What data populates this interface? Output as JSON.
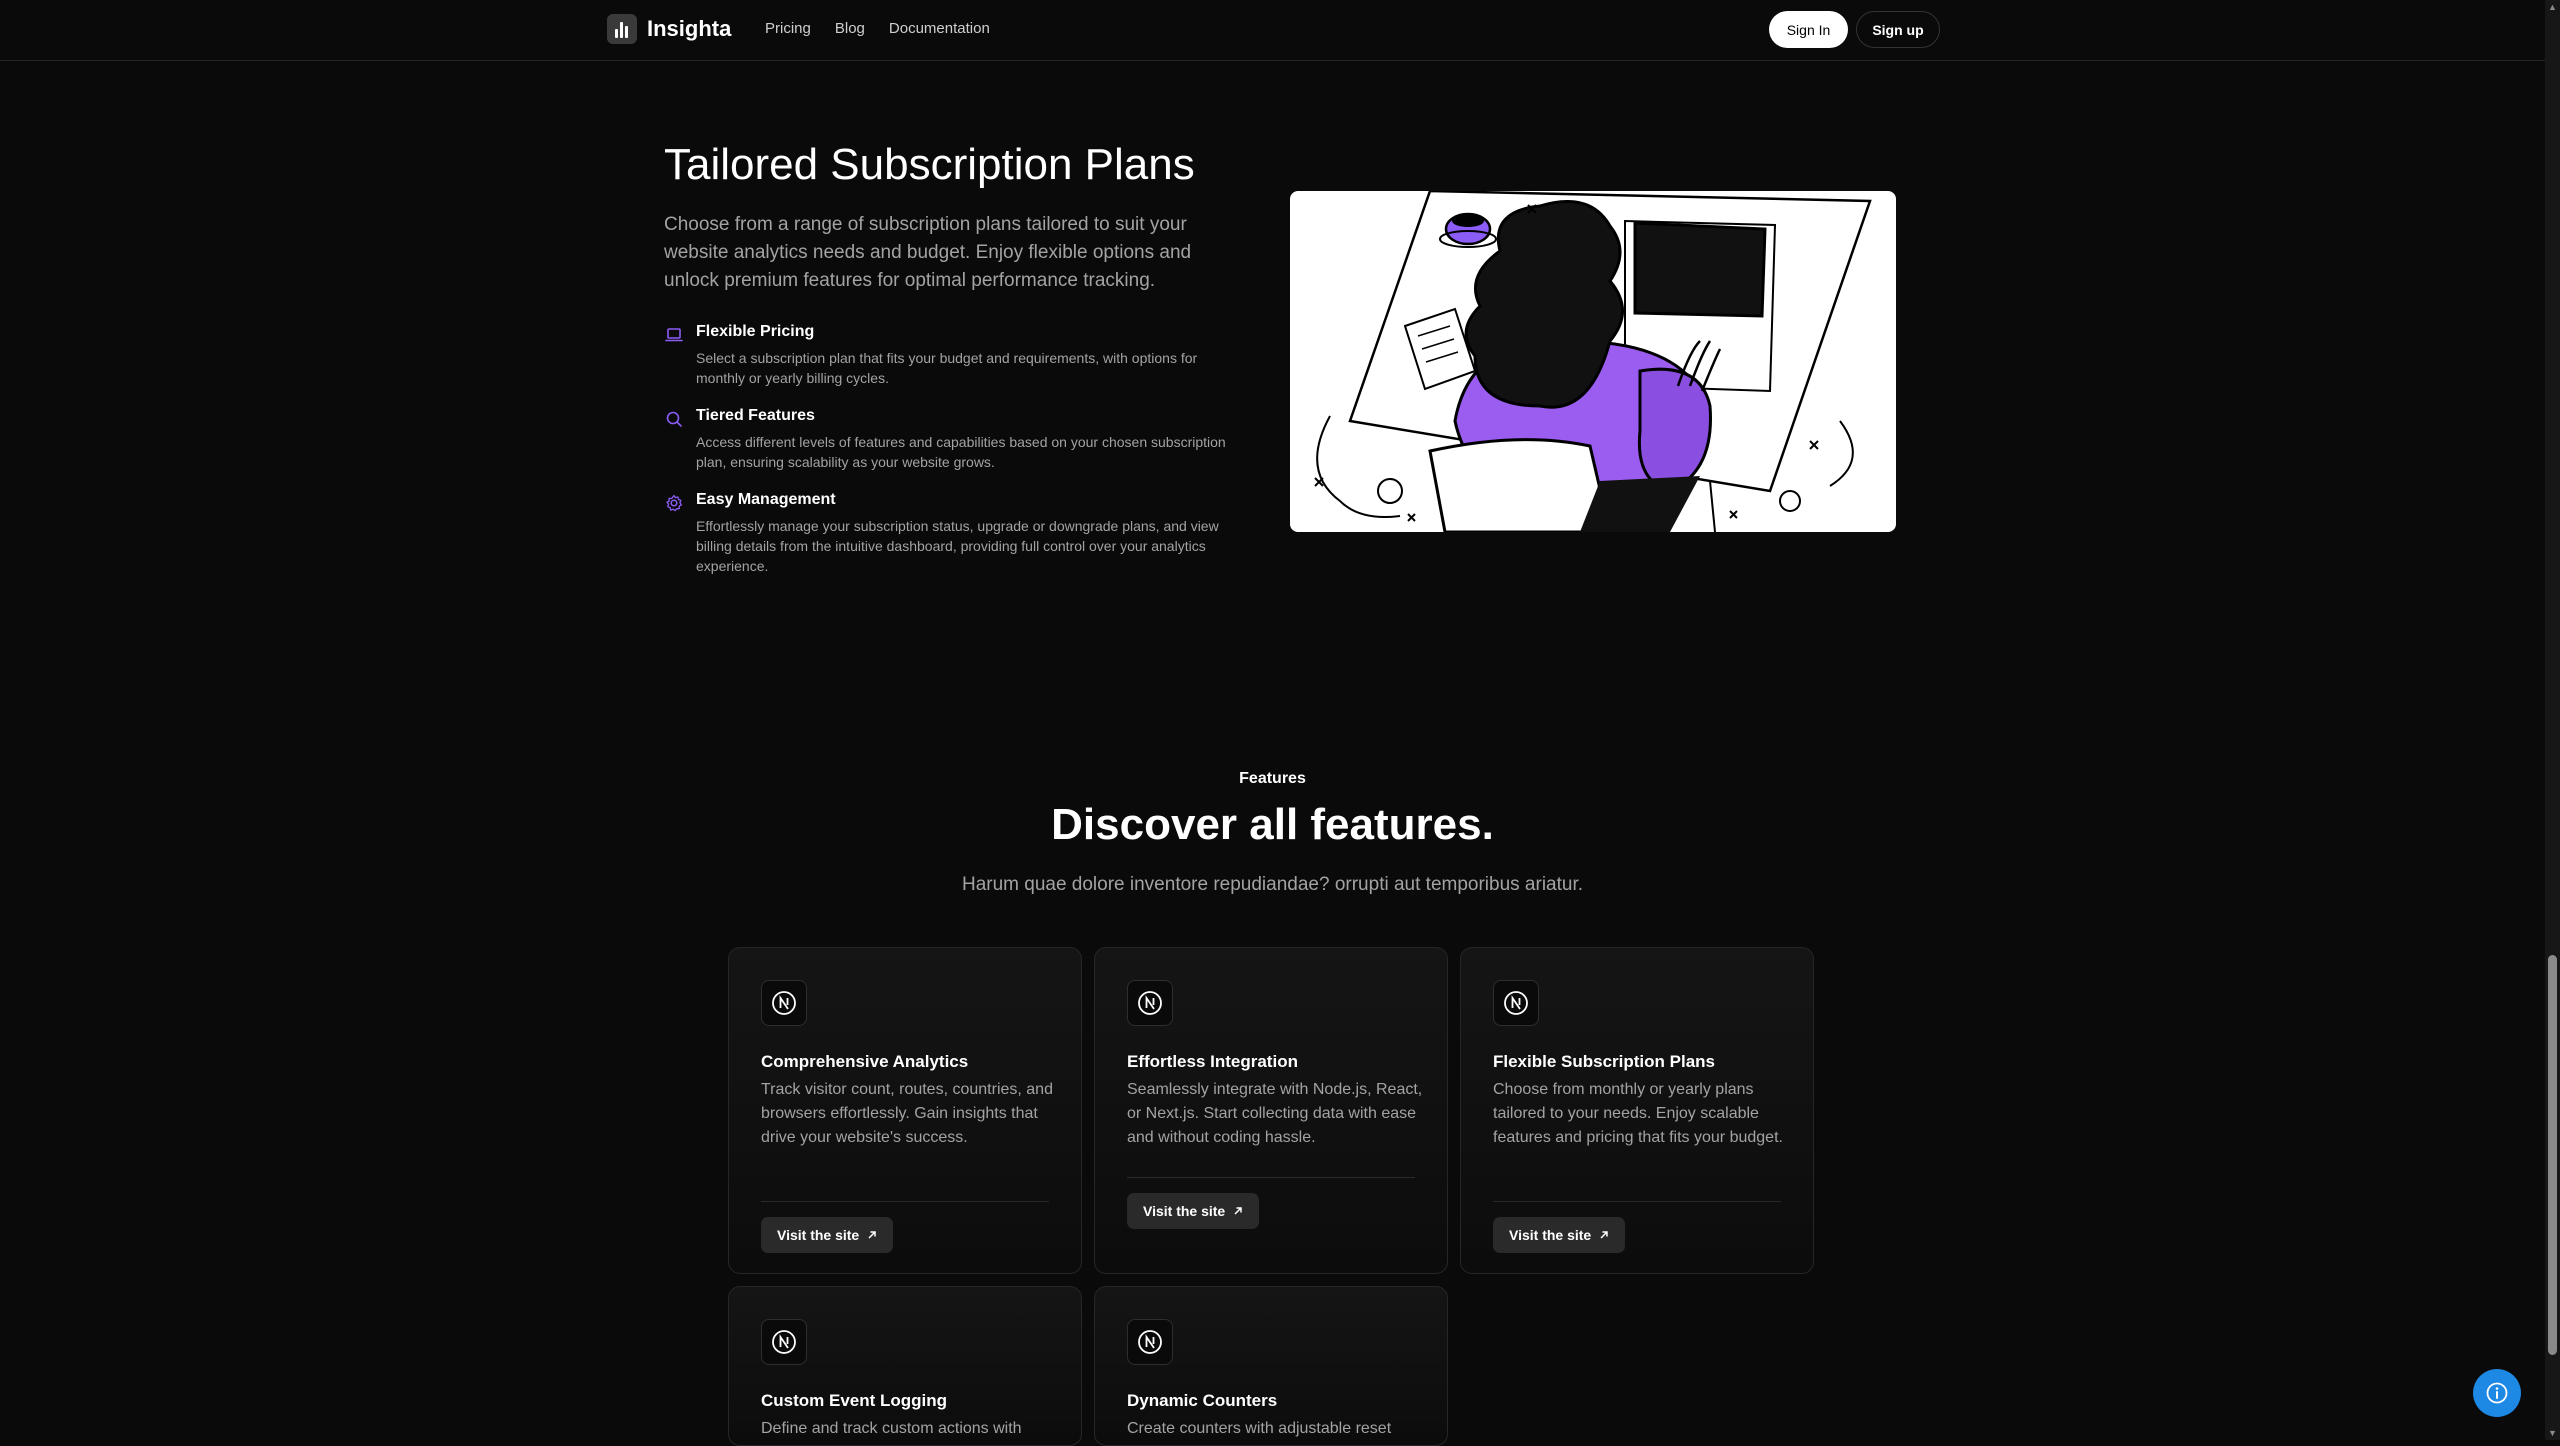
{
  "nav": {
    "brand": "Insighta",
    "links": [
      "Pricing",
      "Blog",
      "Documentation"
    ],
    "sign_in": "Sign In",
    "sign_up": "Sign up"
  },
  "plans_section": {
    "title": "Tailored Subscription Plans",
    "description": "Choose from a range of subscription plans tailored to suit your website analytics needs and budget. Enjoy flexible options and unlock premium features for optimal performance tracking.",
    "features": [
      {
        "icon": "laptop-icon",
        "name": "Flexible Pricing",
        "description": "Select a subscription plan that fits your budget and requirements, with options for monthly or yearly billing cycles."
      },
      {
        "icon": "search-icon",
        "name": "Tiered Features",
        "description": "Access different levels of features and capabilities based on your chosen subscription plan, ensuring scalability as your website grows."
      },
      {
        "icon": "gear-icon",
        "name": "Easy Management",
        "description": "Effortlessly manage your subscription status, upgrade or downgrade plans, and view billing details from the intuitive dashboard, providing full control over your analytics experience."
      }
    ],
    "accent_color": "#8b5cf6"
  },
  "features_section": {
    "eyebrow": "Features",
    "title": "Discover all features.",
    "subtitle": "Harum quae dolore inventore repudiandae? orrupti aut temporibus ariatur.",
    "cards": [
      {
        "icon": "nextjs-icon",
        "title": "Comprehensive Analytics",
        "description": "Track visitor count, routes, countries, and browsers effortlessly. Gain insights that drive your website's success.",
        "button": "Visit the site"
      },
      {
        "icon": "nextjs-icon",
        "title": "Effortless Integration",
        "description": "Seamlessly integrate with Node.js, React, or Next.js. Start collecting data with ease and without coding hassle.",
        "button": "Visit the site"
      },
      {
        "icon": "nextjs-icon",
        "title": "Flexible Subscription Plans",
        "description": "Choose from monthly or yearly plans tailored to your needs. Enjoy scalable features and pricing that fits your budget.",
        "button": "Visit the site"
      },
      {
        "icon": "nextjs-icon",
        "title": "Custom Event Logging",
        "description": "Define and track custom actions with"
      },
      {
        "icon": "nextjs-icon",
        "title": "Dynamic Counters",
        "description": "Create counters with adjustable reset"
      }
    ]
  },
  "fab": {
    "icon": "info-icon",
    "color": "#1e88e5"
  }
}
